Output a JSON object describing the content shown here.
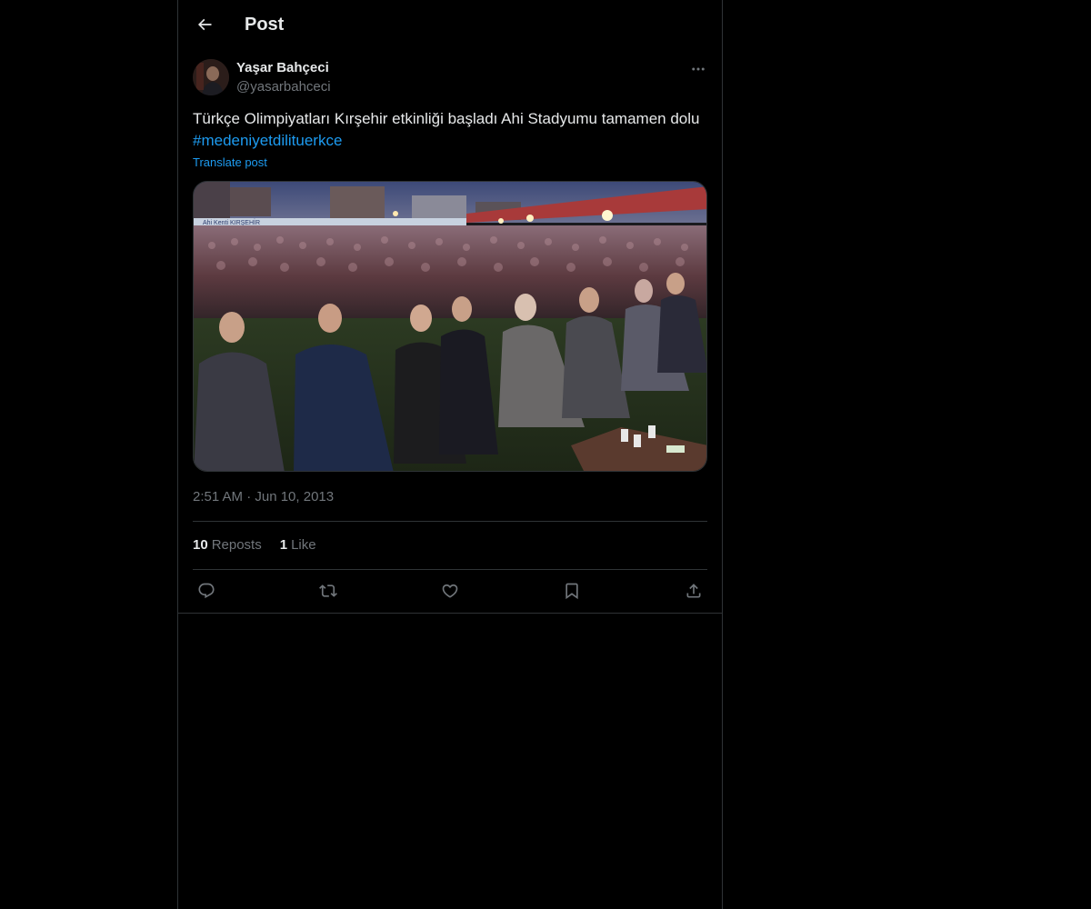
{
  "header": {
    "title": "Post",
    "back_icon": "arrow-left-icon"
  },
  "post": {
    "author_name": "Yaşar Bahçeci",
    "author_handle": "@yasarbahceci",
    "text": "Türkçe Olimpiyatları Kırşehir etkinliği başladı Ahi Stadyumu tamamen dolu ",
    "hashtag": "#medeniyetdilituerkce",
    "translate_label": "Translate post",
    "image_banner_text": "Ahi Kenti KIRŞEHİR",
    "timestamp": "2:51 AM · Jun 10, 2013",
    "reposts_count": "10",
    "reposts_label": "Reposts",
    "likes_count": "1",
    "likes_label": "Like"
  },
  "actions": [
    "reply-icon",
    "repost-icon",
    "like-icon",
    "bookmark-icon",
    "share-icon"
  ],
  "colors": {
    "background": "#000000",
    "text_primary": "#e7e9ea",
    "text_secondary": "#71767b",
    "accent": "#1d9bf0",
    "border": "#2f3336"
  }
}
